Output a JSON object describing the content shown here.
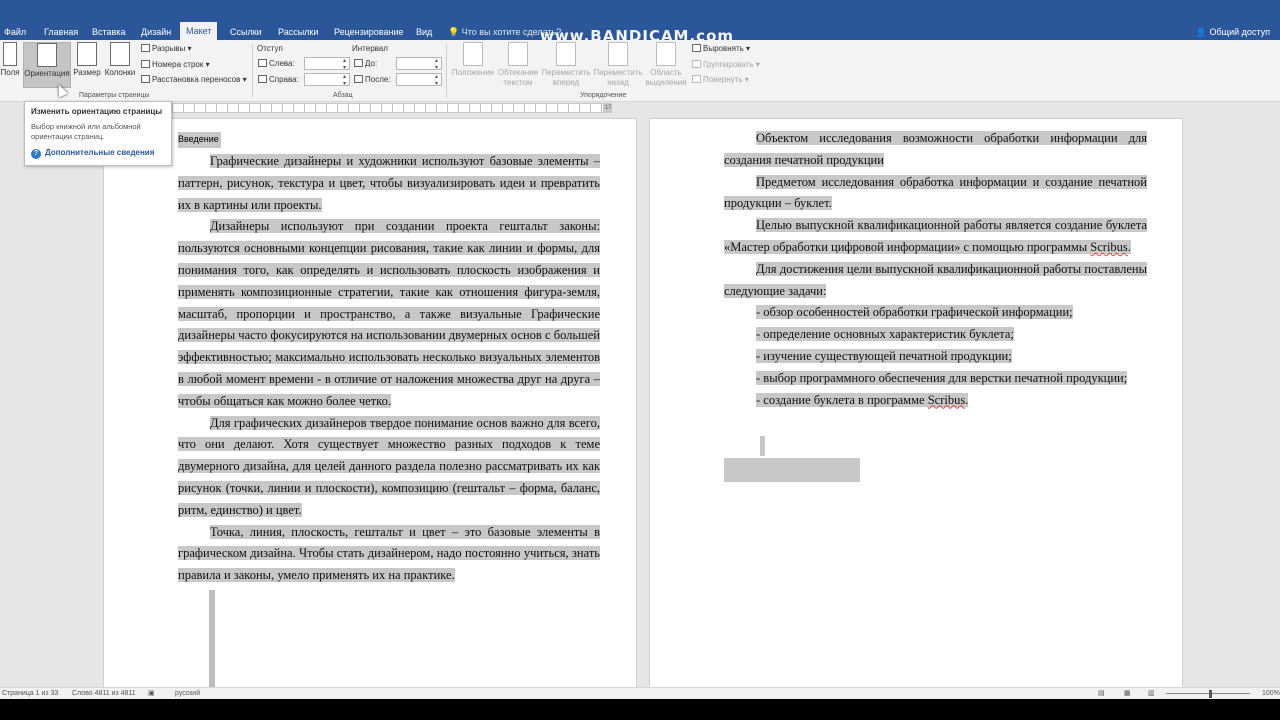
{
  "tabs": {
    "file": "Файл",
    "home": "Главная",
    "insert": "Вставка",
    "design": "Дизайн",
    "layout": "Макет",
    "references": "Ссылки",
    "mailings": "Рассылки",
    "review": "Рецензирование",
    "view": "Вид"
  },
  "tell_me": "Что вы хотите сделать?",
  "share": "Общий доступ",
  "watermark": "www.BANDICAM.com",
  "ribbon": {
    "page_setup": {
      "margins": "Поля",
      "orientation": "Ориентация",
      "size": "Размер",
      "columns": "Колонки",
      "breaks": "Разрывы",
      "line_numbers": "Номера строк",
      "hyphenation": "Расстановка переносов",
      "group_label": "Параметры страницы"
    },
    "paragraph": {
      "indent_label": "Отступ",
      "left": "Слева:",
      "right": "Справа:",
      "spacing_label": "Интервал",
      "before": "До:",
      "after": "После:",
      "group_label": "Абзац"
    },
    "arrange": {
      "position": "Положение",
      "wrap_text": "Обтекание текстом",
      "bring_forward": "Переместить вперед",
      "send_backward": "Переместить назад",
      "selection_pane": "Область выделения",
      "align": "Выровнять",
      "group": "Группировать",
      "rotate": "Повернуть",
      "group_label": "Упорядочение"
    }
  },
  "tooltip": {
    "title": "Изменить ориентацию страницы",
    "description": "Выбор книжной или альбомной ориентации страниц.",
    "more_info": "Дополнительные сведения"
  },
  "ruler_marker": "17",
  "document": {
    "heading": "Введение",
    "left_paragraphs": [
      "Графические дизайнеры и художники используют базовые элементы – паттерн, рисунок, текстура и цвет, чтобы визуализировать идеи и превратить их в картины или проекты.",
      "Дизайнеры используют при создании проекта гештальт законы: пользуются основными концепции рисования, такие как линии и формы, для понимания того, как определять и использовать плоскость изображения и применять композиционные стратегии, такие как отношения фигура-земля, масштаб, пропорции и пространство, а также визуальные Графические дизайнеры часто фокусируются на использовании двумерных основ с большей эффективностью; максимально использовать несколько визуальных элементов в любой момент времени - в отличие от наложения множества друг на друга – чтобы общаться как можно более четко.",
      "Для графических дизайнеров твердое понимание основ важно для всего, что они делают. Хотя существует множество разных подходов к теме двумерного дизайна, для целей данного раздела полезно рассматривать их как рисунок (точки, линии и плоскости), композицию (гештальт – форма, баланс, ритм, единство) и цвет.",
      "Точка, линия, плоскость, гештальт и цвет – это базовые элементы в графическом дизайна. Чтобы стать дизайнером, надо постоянно учиться, знать правила и законы, умело применять их на практике."
    ],
    "right": {
      "p1": "Объектом исследования возможности обработки информации для создания печатной продукции",
      "p2": "Предметом исследования обработка информации и создание печатной продукции – буклет.",
      "p3_before": "Целью выпускной квалификационной работы является создание буклета «Мастер обработки цифровой информации» с помощью программы ",
      "scribus": "Scribus",
      "p3_after": ".",
      "p4": "Для достижения цели выпускной квалификационной работы поставлены следующие задачи:",
      "b1": "- обзор особенностей обработки графической информации;",
      "b2": "- определение основных характеристик буклета;",
      "b3": "- изучение существующей печатной продукции;",
      "b4": "- выбор программного обеспечения для верстки печатной продукции;",
      "b5_before": "- создание буклета в программе ",
      "b5_after": "."
    }
  },
  "statusbar": {
    "page": "Страница 1 из 33",
    "words": "Слово 4811 из 4811",
    "language": "русский",
    "zoom": "100%"
  },
  "colors": {
    "ribbon_blue": "#2b579a",
    "selection": "#c8c8c8"
  }
}
